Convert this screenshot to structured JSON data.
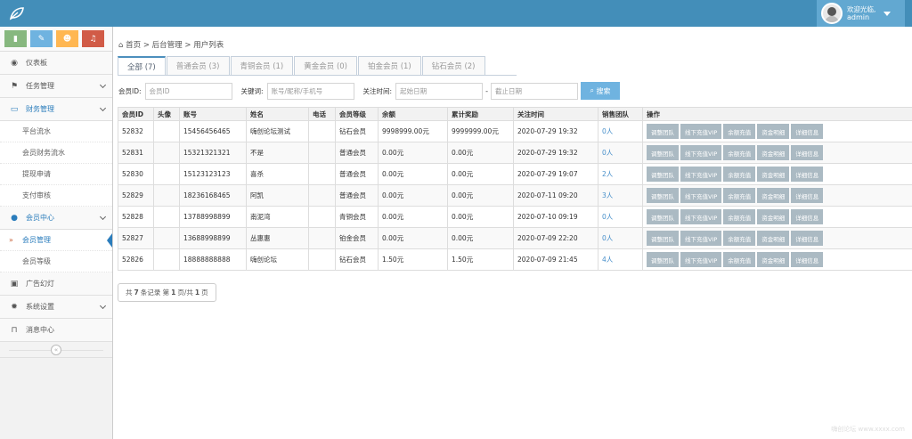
{
  "header": {
    "welcome": "欢迎光临,",
    "username": "admin"
  },
  "shortcuts": [
    {
      "icon": "signal-icon",
      "glyph": "▮",
      "color": "#87b87f"
    },
    {
      "icon": "pencil-icon",
      "glyph": "✎",
      "color": "#6fb3e0"
    },
    {
      "icon": "users-icon",
      "glyph": "☻",
      "color": "#ffb752"
    },
    {
      "icon": "bell-icon",
      "glyph": "♫",
      "color": "#d15b47"
    }
  ],
  "sidebar": {
    "dashboard": "仪表板",
    "task": "任务管理",
    "finance": "财务管理",
    "finance_sub": [
      "平台流水",
      "会员财务流水",
      "提现申请",
      "支付审核"
    ],
    "member": "会员中心",
    "member_sub": [
      "会员管理",
      "会员等级"
    ],
    "ads": "广告幻灯",
    "settings": "系统设置",
    "messages": "消息中心",
    "collapse": "«"
  },
  "breadcrumb": {
    "home": "首页",
    "sep1": ">",
    "admin": "后台管理",
    "sep2": ">",
    "current": "用户列表"
  },
  "tabs": [
    "全部 (7)",
    "普通会员 (3)",
    "青铜会员 (1)",
    "黄金会员 (0)",
    "铂金会员 (1)",
    "钻石会员 (2)"
  ],
  "search": {
    "member_id_label": "会员ID:",
    "member_id_placeholder": "会员ID",
    "keyword_label": "关键词:",
    "keyword_placeholder": "账号/昵称/手机号",
    "time_label": "关注时间:",
    "start_placeholder": "起始日期",
    "dash": "-",
    "end_placeholder": "截止日期",
    "button": "搜索"
  },
  "table": {
    "headers": [
      "会员ID",
      "头像",
      "账号",
      "姓名",
      "电话",
      "会员等级",
      "余额",
      "累计奖励",
      "关注时间",
      "销售团队",
      "操作"
    ],
    "ops": [
      "调整团队",
      "线下充值VIP",
      "余额充值",
      "资金明细",
      "详细信息"
    ],
    "rows": [
      {
        "id": "52832",
        "avatar": "",
        "account": "15456456465",
        "name": "嗨创论坛测试",
        "phone": "",
        "level": "钻石会员",
        "balance": "9998999.00元",
        "reward": "9999999.00元",
        "time": "2020-07-29 19:32",
        "team": "0人"
      },
      {
        "id": "52831",
        "avatar": "",
        "account": "15321321321",
        "name": "不是",
        "phone": "",
        "level": "普通会员",
        "balance": "0.00元",
        "reward": "0.00元",
        "time": "2020-07-29 19:32",
        "team": "0人"
      },
      {
        "id": "52830",
        "avatar": "",
        "account": "15123123123",
        "name": "喜杀",
        "phone": "",
        "level": "普通会员",
        "balance": "0.00元",
        "reward": "0.00元",
        "time": "2020-07-29 19:07",
        "team": "2人"
      },
      {
        "id": "52829",
        "avatar": "",
        "account": "18236168465",
        "name": "阿凯",
        "phone": "",
        "level": "普通会员",
        "balance": "0.00元",
        "reward": "0.00元",
        "time": "2020-07-11 09:20",
        "team": "3人"
      },
      {
        "id": "52828",
        "avatar": "",
        "account": "13788998899",
        "name": "南泥湾",
        "phone": "",
        "level": "青铜会员",
        "balance": "0.00元",
        "reward": "0.00元",
        "time": "2020-07-10 09:19",
        "team": "0人"
      },
      {
        "id": "52827",
        "avatar": "",
        "account": "13688998899",
        "name": "丛惠惠",
        "phone": "",
        "level": "铂金会员",
        "balance": "0.00元",
        "reward": "0.00元",
        "time": "2020-07-09 22:20",
        "team": "0人"
      },
      {
        "id": "52826",
        "avatar": "",
        "account": "18888888888",
        "name": "嗨创论坛",
        "phone": "",
        "level": "钻石会员",
        "balance": "1.50元",
        "reward": "1.50元",
        "time": "2020-07-09 21:45",
        "team": "4人"
      }
    ]
  },
  "pager": {
    "prefix": "共",
    "records": "7",
    "mid1": "条记录 第",
    "page": "1",
    "mid2": "页/共",
    "total_pages": "1",
    "suffix": "页"
  },
  "watermark": "嗨创论坛 www.xxxx.com"
}
